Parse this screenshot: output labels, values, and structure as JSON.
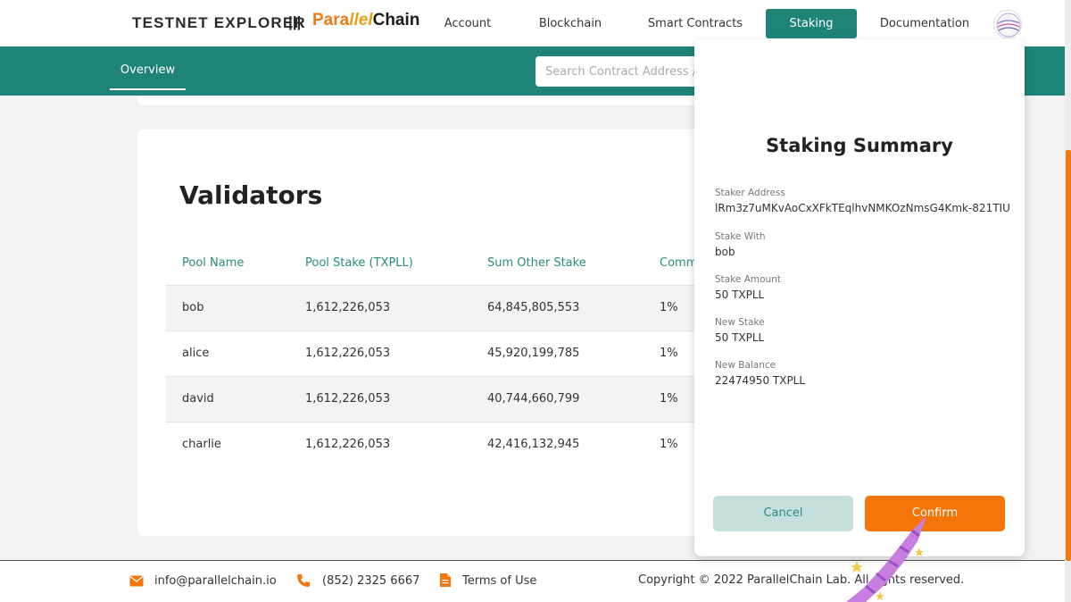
{
  "header": {
    "brand": "TESTNET EXPLORER",
    "separator": "|||",
    "logo": {
      "part1": "Para",
      "part2": "llel",
      "part3": "Chain"
    },
    "nav": [
      "Account",
      "Blockchain",
      "Smart Contracts",
      "Staking",
      "Documentation"
    ],
    "active_nav": "Staking"
  },
  "subheader": {
    "tab": "Overview",
    "search_placeholder": "Search Contract Address /"
  },
  "validators": {
    "title": "Validators",
    "columns": [
      "Pool Name",
      "Pool Stake (TXPLL)",
      "Sum Other Stake",
      "Comm"
    ],
    "rows": [
      {
        "pool_name": "bob",
        "pool_stake": "1,612,226,053",
        "sum_other_stake": "64,845,805,553",
        "commission": "1%"
      },
      {
        "pool_name": "alice",
        "pool_stake": "1,612,226,053",
        "sum_other_stake": "45,920,199,785",
        "commission": "1%"
      },
      {
        "pool_name": "david",
        "pool_stake": "1,612,226,053",
        "sum_other_stake": "40,744,660,799",
        "commission": "1%"
      },
      {
        "pool_name": "charlie",
        "pool_stake": "1,612,226,053",
        "sum_other_stake": "42,416,132,945",
        "commission": "1%"
      }
    ]
  },
  "modal": {
    "title": "Staking Summary",
    "fields": [
      {
        "label": "Staker Address",
        "value": "lRm3z7uMKvAoCxXFkTEqlhvNMKOzNmsG4Kmk-821TIU"
      },
      {
        "label": "Stake With",
        "value": "bob"
      },
      {
        "label": "Stake Amount",
        "value": "50 TXPLL"
      },
      {
        "label": "New Stake",
        "value": "50 TXPLL"
      },
      {
        "label": "New Balance",
        "value": "22474950 TXPLL"
      }
    ],
    "cancel_label": "Cancel",
    "confirm_label": "Confirm"
  },
  "footer": {
    "email": "info@parallelchain.io",
    "phone": "(852) 2325 6667",
    "terms": "Terms of Use",
    "copyright": "Copyright © 2022 ParallelChain Lab. All rights reserved."
  },
  "colors": {
    "teal": "#1f8378",
    "orange": "#f57508",
    "cancel_bg": "#c5dfdd"
  }
}
